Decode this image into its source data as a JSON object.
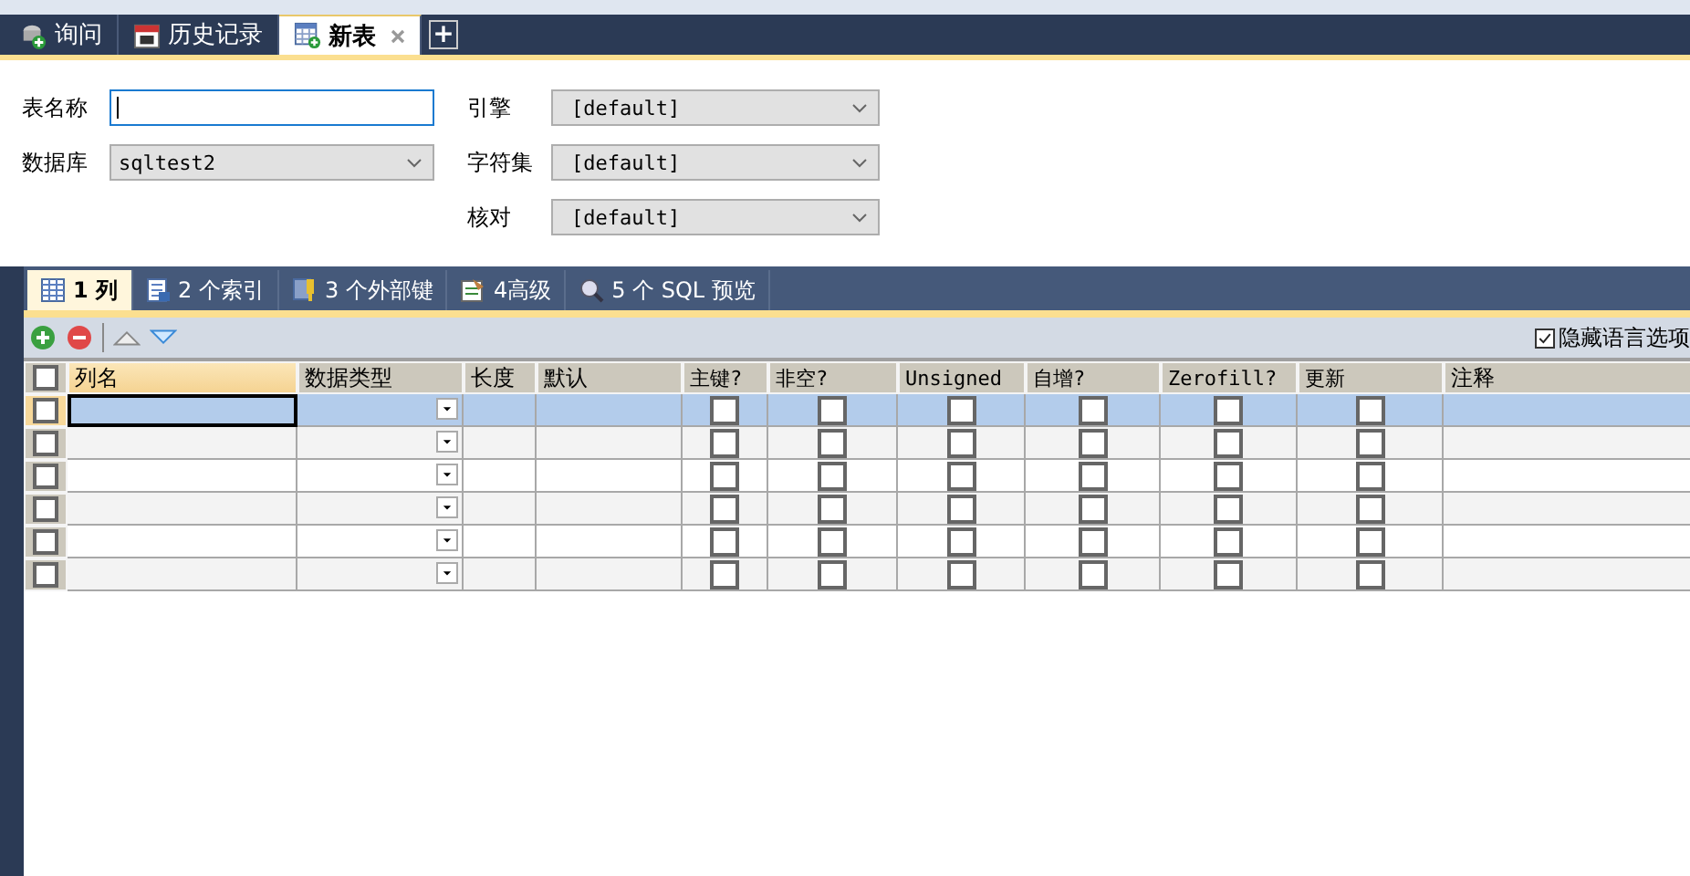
{
  "tabs": [
    {
      "label": "询问",
      "kind": "query",
      "selected": false,
      "closable": false
    },
    {
      "label": "历史记录",
      "kind": "history",
      "selected": false,
      "closable": false
    },
    {
      "label": "新表",
      "kind": "table",
      "selected": true,
      "closable": true
    }
  ],
  "new_tab_button": "+",
  "form": {
    "left": [
      {
        "label": "表名称",
        "kind": "input",
        "focused": true
      },
      {
        "label": "数据库",
        "kind": "select",
        "value": "sqltest2"
      }
    ],
    "right": [
      {
        "label": "引擎",
        "value": "[default]"
      },
      {
        "label": "字符集",
        "value": "[default]"
      },
      {
        "label": "核对",
        "value": "[default]"
      }
    ]
  },
  "subtabs": [
    {
      "label": "1 列",
      "kind": "columns",
      "selected": true
    },
    {
      "label": "2 个索引",
      "kind": "index",
      "selected": false
    },
    {
      "label": "3 个外部键",
      "kind": "key",
      "selected": false
    },
    {
      "label": "4高级",
      "kind": "advanced",
      "selected": false
    },
    {
      "label": "5 个 SQL 预览",
      "kind": "sql",
      "selected": false
    }
  ],
  "hide_language_options": {
    "label": "隐藏语言选项",
    "checked": true
  },
  "grid": {
    "header_checked": false,
    "columns": [
      {
        "label": "列名",
        "kind": "text"
      },
      {
        "label": "数据类型",
        "kind": "dropdown"
      },
      {
        "label": "长度",
        "kind": "text"
      },
      {
        "label": "默认",
        "kind": "text"
      },
      {
        "label": "主键?",
        "kind": "check"
      },
      {
        "label": "非空?",
        "kind": "check"
      },
      {
        "label": "Unsigned",
        "kind": "check"
      },
      {
        "label": "自增?",
        "kind": "check"
      },
      {
        "label": "Zerofill?",
        "kind": "check"
      },
      {
        "label": "更新",
        "kind": "check"
      },
      {
        "label": "注释",
        "kind": "text"
      }
    ],
    "rows": [
      {
        "selected": true,
        "checked": false,
        "flags": [
          false,
          false,
          false,
          false,
          false,
          false
        ]
      },
      {
        "selected": false,
        "checked": false,
        "flags": [
          false,
          false,
          false,
          false,
          false,
          false
        ]
      },
      {
        "selected": false,
        "checked": false,
        "flags": [
          false,
          false,
          false,
          false,
          false,
          false
        ]
      },
      {
        "selected": false,
        "checked": false,
        "flags": [
          false,
          false,
          false,
          false,
          false,
          false
        ]
      },
      {
        "selected": false,
        "checked": false,
        "flags": [
          false,
          false,
          false,
          false,
          false,
          false
        ]
      },
      {
        "selected": false,
        "checked": false,
        "flags": [
          false,
          false,
          false,
          false,
          false,
          false
        ]
      }
    ]
  }
}
